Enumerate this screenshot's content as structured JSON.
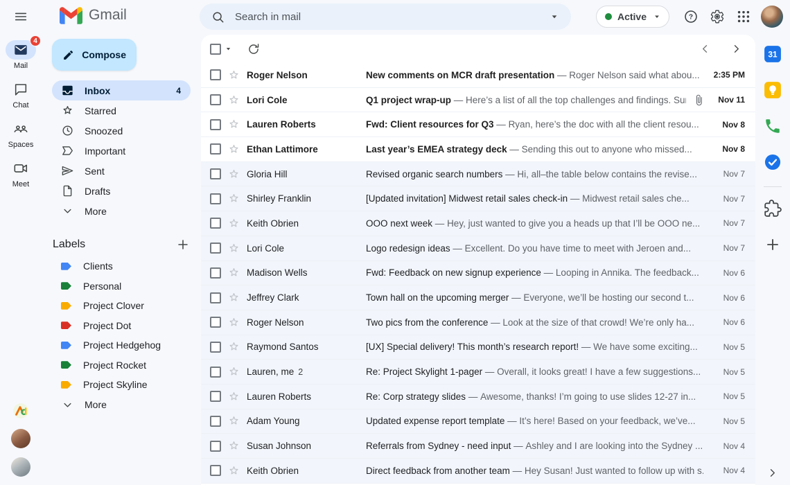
{
  "header": {
    "app_name": "Gmail",
    "search_placeholder": "Search in mail",
    "status": {
      "label": "Active"
    }
  },
  "left_rail": {
    "items": [
      {
        "label": "Mail",
        "icon": "mail",
        "badge": "4",
        "active": true
      },
      {
        "label": "Chat",
        "icon": "chat"
      },
      {
        "label": "Spaces",
        "icon": "spaces"
      },
      {
        "label": "Meet",
        "icon": "meet"
      }
    ]
  },
  "sidebar": {
    "compose_label": "Compose",
    "nav": [
      {
        "label": "Inbox",
        "icon": "inbox",
        "count": "4",
        "active": true
      },
      {
        "label": "Starred",
        "icon": "star"
      },
      {
        "label": "Snoozed",
        "icon": "clock"
      },
      {
        "label": "Important",
        "icon": "important"
      },
      {
        "label": "Sent",
        "icon": "send"
      },
      {
        "label": "Drafts",
        "icon": "draft"
      },
      {
        "label": "More",
        "icon": "chevron-down"
      }
    ],
    "labels_header": "Labels",
    "labels": [
      {
        "name": "Clients",
        "color": "#4285f4"
      },
      {
        "name": "Personal",
        "color": "#188038"
      },
      {
        "name": "Project Clover",
        "color": "#f9ab00"
      },
      {
        "name": "Project Dot",
        "color": "#d93025"
      },
      {
        "name": "Project Hedgehog",
        "color": "#4285f4"
      },
      {
        "name": "Project Rocket",
        "color": "#188038"
      },
      {
        "name": "Project Skyline",
        "color": "#f9ab00"
      }
    ],
    "labels_more": "More"
  },
  "list": {
    "separator": "—",
    "rows": [
      {
        "sender": "Roger Nelson",
        "subject": "New comments on MCR draft presentation",
        "snippet": "Roger Nelson said what abou...",
        "date": "2:35 PM",
        "unread": true
      },
      {
        "sender": "Lori Cole",
        "subject": "Q1 project wrap-up",
        "snippet": "Here’s a list of all the top challenges and findings. Sur...",
        "date": "Nov 11",
        "unread": true,
        "attachment": true
      },
      {
        "sender": "Lauren Roberts",
        "subject": "Fwd: Client resources for Q3",
        "snippet": "Ryan, here’s the doc with all the client resou...",
        "date": "Nov 8",
        "unread": true
      },
      {
        "sender": "Ethan Lattimore",
        "subject": "Last year’s EMEA strategy deck",
        "snippet": "Sending this out to anyone who missed...",
        "date": "Nov 8",
        "unread": true
      },
      {
        "sender": "Gloria Hill",
        "subject": "Revised organic search numbers",
        "snippet": "Hi, all–the table below contains the revise...",
        "date": "Nov 7"
      },
      {
        "sender": "Shirley Franklin",
        "subject": "[Updated invitation] Midwest retail sales check-in",
        "snippet": "Midwest retail sales che...",
        "date": "Nov 7"
      },
      {
        "sender": "Keith Obrien",
        "subject": "OOO next week",
        "snippet": "Hey, just wanted to give you a heads up that I’ll be OOO ne...",
        "date": "Nov 7"
      },
      {
        "sender": "Lori Cole",
        "subject": "Logo redesign ideas",
        "snippet": "Excellent. Do you have time to meet with Jeroen and...",
        "date": "Nov 7"
      },
      {
        "sender": "Madison Wells",
        "subject": "Fwd: Feedback on new signup experience",
        "snippet": "Looping in Annika. The feedback...",
        "date": "Nov 6"
      },
      {
        "sender": "Jeffrey Clark",
        "subject": "Town hall on the upcoming merger",
        "snippet": "Everyone, we’ll be hosting our second t...",
        "date": "Nov 6"
      },
      {
        "sender": "Roger Nelson",
        "subject": "Two pics from the conference",
        "snippet": "Look at the size of that crowd! We’re only ha...",
        "date": "Nov 6"
      },
      {
        "sender": "Raymond Santos",
        "subject": "[UX] Special delivery! This month’s research report!",
        "snippet": "We have some exciting...",
        "date": "Nov 5"
      },
      {
        "sender": "Lauren, me",
        "thread_count": "2",
        "subject": "Re: Project Skylight 1-pager",
        "snippet": "Overall, it looks great! I have a few suggestions...",
        "date": "Nov 5"
      },
      {
        "sender": "Lauren Roberts",
        "subject": "Re: Corp strategy slides",
        "snippet": "Awesome, thanks! I’m going to use slides 12-27 in...",
        "date": "Nov 5"
      },
      {
        "sender": "Adam Young",
        "subject": "Updated expense report template",
        "snippet": "It’s here! Based on your feedback, we’ve...",
        "date": "Nov 5"
      },
      {
        "sender": "Susan Johnson",
        "subject": "Referrals from Sydney - need input",
        "snippet": "Ashley and I are looking into the Sydney ...",
        "date": "Nov 4"
      },
      {
        "sender": "Keith Obrien",
        "subject": "Direct feedback from another team",
        "snippet": "Hey Susan! Just wanted to follow up with s...",
        "date": "Nov 4"
      }
    ]
  },
  "side_panel": {
    "items": [
      {
        "icon": "calendar"
      },
      {
        "icon": "keep"
      },
      {
        "icon": "voice"
      },
      {
        "icon": "tasks"
      },
      {
        "type": "divider"
      },
      {
        "icon": "puzzle"
      },
      {
        "icon": "plus"
      }
    ]
  },
  "colors": {
    "background": "#f6f8fc",
    "search_bar": "#eaf1fb",
    "selected_pill": "#d3e3fd",
    "compose_button": "#c2e7ff",
    "unread_badge": "#e94235",
    "active_dot": "#1e8e3e",
    "read_row": "#f2f6fc",
    "unread_row": "#ffffff"
  }
}
